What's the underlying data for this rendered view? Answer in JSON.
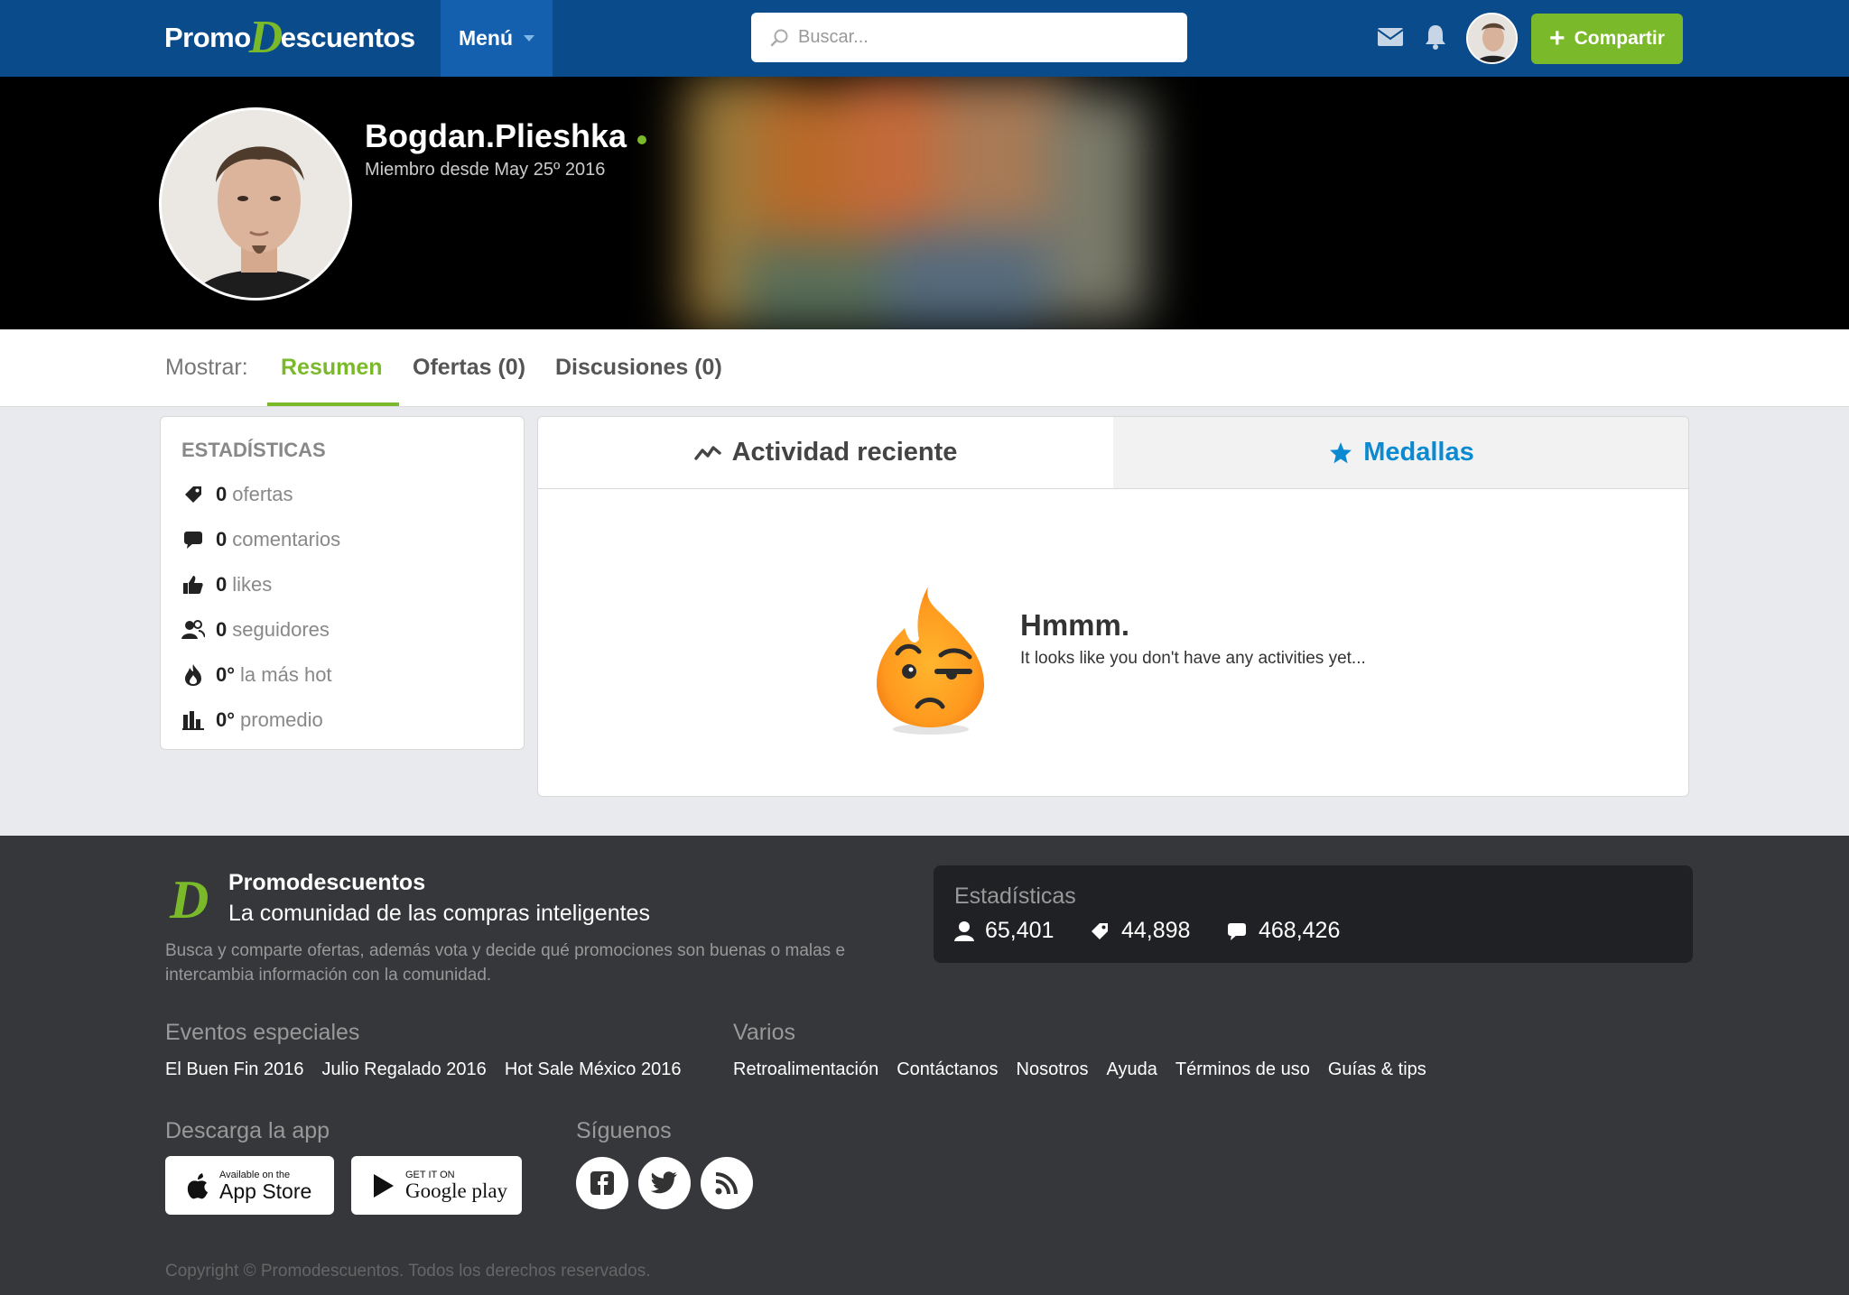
{
  "nav": {
    "logo_left": "Promo",
    "logo_d": "D",
    "logo_right": "escuentos",
    "menu_label": "Menú",
    "search_placeholder": "Buscar...",
    "share_label": "Compartir"
  },
  "profile": {
    "username": "Bogdan.Plieshka",
    "member_since": "Miembro desde May 25º 2016"
  },
  "tabs": {
    "show_label": "Mostrar:",
    "items": [
      {
        "label": "Resumen",
        "active": true
      },
      {
        "label": "Ofertas (0)",
        "active": false
      },
      {
        "label": "Discusiones (0)",
        "active": false
      }
    ]
  },
  "stats": {
    "title": "ESTADÍSTICAS",
    "rows": [
      {
        "icon": "tag-icon",
        "value": "0",
        "label": "ofertas"
      },
      {
        "icon": "comment-icon",
        "value": "0",
        "label": "comentarios"
      },
      {
        "icon": "thumbs-up-icon",
        "value": "0",
        "label": "likes"
      },
      {
        "icon": "users-icon",
        "value": "0",
        "label": "seguidores"
      },
      {
        "icon": "flame-icon",
        "value": "0°",
        "label": "la más hot"
      },
      {
        "icon": "bar-chart-icon",
        "value": "0°",
        "label": "promedio"
      }
    ]
  },
  "activity": {
    "tab_recent": "Actividad reciente",
    "tab_medals": "Medallas",
    "empty_title": "Hmmm.",
    "empty_message": "It looks like you don't have any activities yet..."
  },
  "footer": {
    "brand": "Promodescuentos",
    "tagline": "La comunidad de las compras inteligentes",
    "description": "Busca y comparte ofertas, además vota y decide qué promociones son buenas o malas e intercambia información con la comunidad.",
    "stats_title": "Estadísticas",
    "stats": [
      {
        "icon": "user-icon",
        "value": "65,401"
      },
      {
        "icon": "tag-icon",
        "value": "44,898"
      },
      {
        "icon": "comment-icon",
        "value": "468,426"
      }
    ],
    "events_title": "Eventos especiales",
    "events": [
      "El Buen Fin 2016",
      "Julio Regalado 2016",
      "Hot Sale México 2016"
    ],
    "misc_title": "Varios",
    "misc": [
      "Retroalimentación",
      "Contáctanos",
      "Nosotros",
      "Ayuda",
      "Términos de uso",
      "Guías & tips"
    ],
    "app_title": "Descarga la app",
    "appstore_small": "Available on the",
    "appstore_big": "App Store",
    "googleplay_small": "GET IT ON",
    "googleplay_big": "Google play",
    "follow_title": "Síguenos",
    "copyright": "Copyright © Promodescuentos. Todos los derechos reservados."
  },
  "colors": {
    "nav_bg": "#0a4b8c",
    "menu_bg": "#1560ae",
    "brand_green": "#7ab929",
    "medal_blue": "#0b8ad1",
    "footer_bg": "#36373a"
  }
}
